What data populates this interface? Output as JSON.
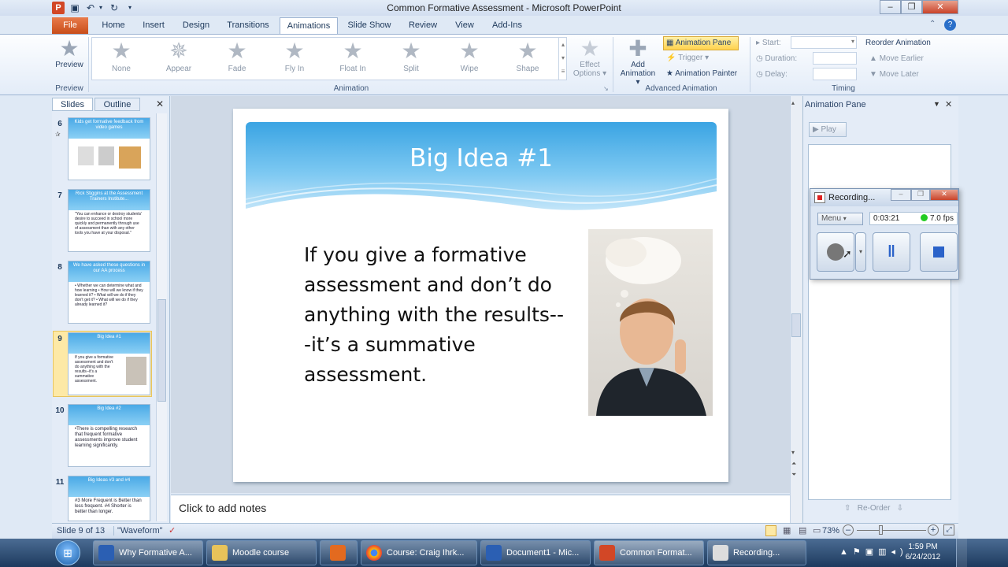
{
  "window": {
    "title": "Common Formative Assessment - Microsoft PowerPoint"
  },
  "ribbon_tabs": [
    "File",
    "Home",
    "Insert",
    "Design",
    "Transitions",
    "Animations",
    "Slide Show",
    "Review",
    "View",
    "Add-Ins"
  ],
  "active_tab": "Animations",
  "preview": {
    "label": "Preview",
    "group": "Preview"
  },
  "animations": [
    {
      "label": "None"
    },
    {
      "label": "Appear"
    },
    {
      "label": "Fade"
    },
    {
      "label": "Fly In"
    },
    {
      "label": "Float In"
    },
    {
      "label": "Split"
    },
    {
      "label": "Wipe"
    },
    {
      "label": "Shape"
    }
  ],
  "effect_options": {
    "line1": "Effect",
    "line2": "Options"
  },
  "animation_group": "Animation",
  "add_animation": {
    "line1": "Add",
    "line2": "Animation"
  },
  "advanced": {
    "animation_pane": "Animation Pane",
    "trigger": "Trigger",
    "painter": "Animation Painter",
    "group": "Advanced Animation"
  },
  "timing": {
    "start": "Start:",
    "duration": "Duration:",
    "delay": "Delay:",
    "reorder": "Reorder Animation",
    "earlier": "Move Earlier",
    "later": "Move Later",
    "group": "Timing"
  },
  "panel_tabs": {
    "slides": "Slides",
    "outline": "Outline"
  },
  "thumbnails": [
    {
      "num": "6",
      "title": "Kids get formative feedback from video games",
      "text": ""
    },
    {
      "num": "7",
      "title": "Rick Stiggins at the Assessment Trainers Institute...",
      "text": "\"You can enhance or destroy students' desire to succeed in school more quickly and permanently through use of assessment than with any other tools you have at your disposal.\""
    },
    {
      "num": "8",
      "title": "We have asked these questions in our AA process",
      "text": "• Whether we can determine what and how learning • How will we know if they learned it? • What will we do if they don't get it? • What will we do if they already learned it?"
    },
    {
      "num": "9",
      "title": "Big Idea #1",
      "text": "If you give a formative assessment and don't do anything with the results--it's a summative assessment."
    },
    {
      "num": "10",
      "title": "Big Idea #2",
      "text": "•There is compelling research that frequent formative assessments improve student learning significantly."
    },
    {
      "num": "11",
      "title": "Big Ideas #3 and #4",
      "text": "#3 More Frequent is Better than less frequent.  #4 Shorter is better than longer."
    }
  ],
  "slide": {
    "title": "Big Idea #1",
    "body_lines": [
      "If you give a formative",
      "assessment and don’t do",
      "anything with the results--",
      "-it’s a summative",
      "assessment."
    ]
  },
  "notes_placeholder": "Click to add notes",
  "animation_pane": {
    "title": "Animation Pane",
    "play": "Play",
    "reorder": "Re-Order"
  },
  "recording": {
    "title": "Recording...",
    "menu": "Menu",
    "time": "0:03:21",
    "fps": "7.0 fps",
    "status_color": "#22cc22"
  },
  "status": {
    "slide": "Slide 9 of 13",
    "theme": "\"Waveform\"",
    "zoom": "73%"
  },
  "taskbar": {
    "items": [
      "Why Formative A...",
      "Moodle course",
      "",
      "Course: Craig Ihrk...",
      "Document1 - Mic...",
      "Common Format...",
      "Recording..."
    ],
    "time": "1:59 PM",
    "date": "6/24/2012"
  }
}
